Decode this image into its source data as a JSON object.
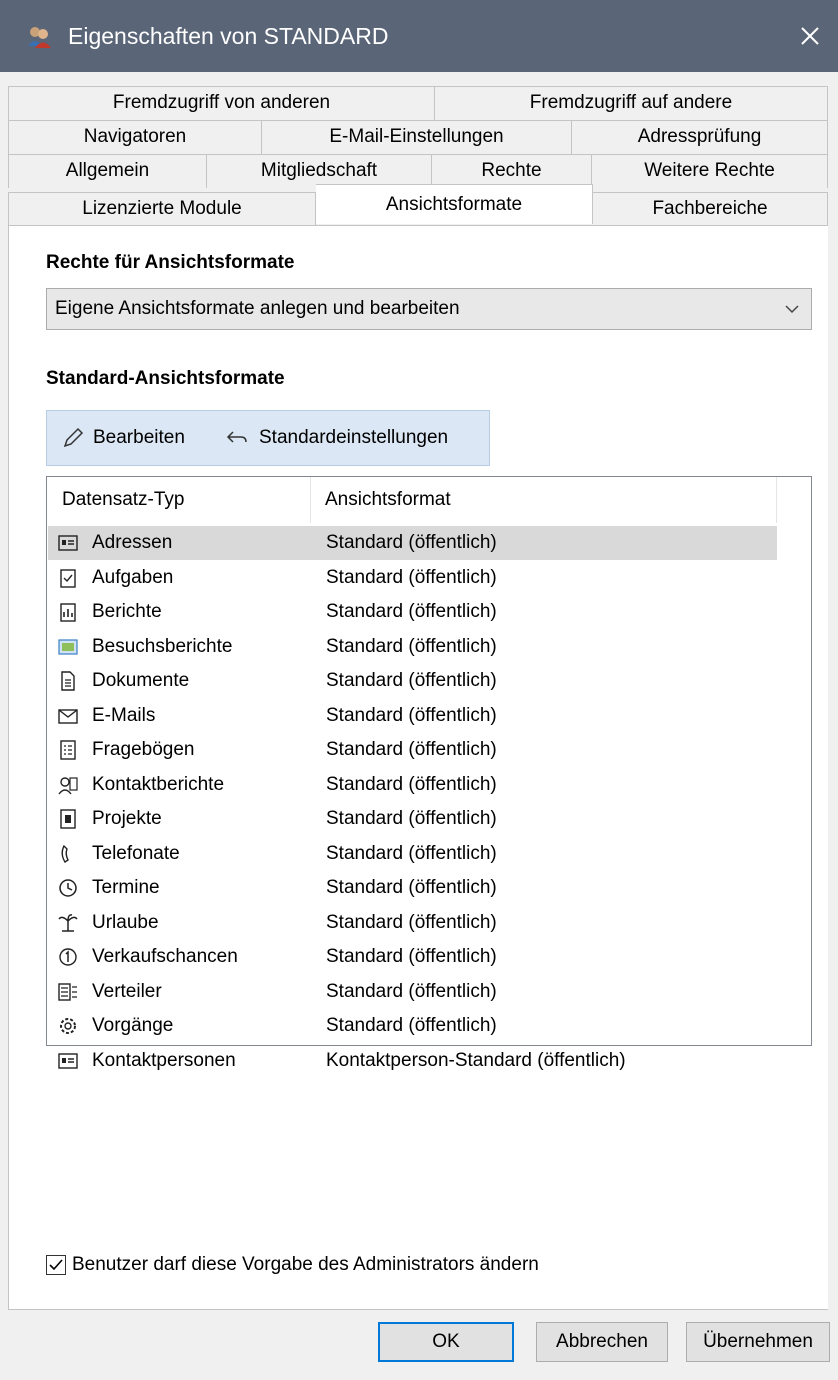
{
  "window": {
    "title": "Eigenschaften von STANDARD"
  },
  "tabs": {
    "row1": [
      "Fremdzugriff von anderen",
      "Fremdzugriff auf andere"
    ],
    "row2": [
      "Navigatoren",
      "E-Mail-Einstellungen",
      "Adressprüfung"
    ],
    "row3": [
      "Allgemein",
      "Mitgliedschaft",
      "Rechte",
      "Weitere Rechte"
    ],
    "row4": [
      "Lizenzierte Module",
      "Ansichtsformate",
      "Fachbereiche"
    ],
    "active": "Ansichtsformate"
  },
  "rights": {
    "title": "Rechte für Ansichtsformate",
    "selected": "Eigene Ansichtsformate anlegen und bearbeiten"
  },
  "standard": {
    "title": "Standard-Ansichtsformate",
    "edit_label": "Bearbeiten",
    "reset_label": "Standardeinstellungen"
  },
  "table": {
    "headers": [
      "Datensatz-Typ",
      "Ansichtsformat"
    ],
    "rows": [
      {
        "type": "Adressen",
        "format": "Standard (öffentlich)",
        "icon": "address-card-icon"
      },
      {
        "type": "Aufgaben",
        "format": "Standard (öffentlich)",
        "icon": "task-icon"
      },
      {
        "type": "Berichte",
        "format": "Standard (öffentlich)",
        "icon": "report-icon"
      },
      {
        "type": "Besuchsberichte",
        "format": "Standard (öffentlich)",
        "icon": "visit-report-icon"
      },
      {
        "type": "Dokumente",
        "format": "Standard (öffentlich)",
        "icon": "document-icon"
      },
      {
        "type": "E-Mails",
        "format": "Standard (öffentlich)",
        "icon": "envelope-icon"
      },
      {
        "type": "Fragebögen",
        "format": "Standard (öffentlich)",
        "icon": "questionnaire-icon"
      },
      {
        "type": "Kontaktberichte",
        "format": "Standard (öffentlich)",
        "icon": "contact-report-icon"
      },
      {
        "type": "Projekte",
        "format": "Standard (öffentlich)",
        "icon": "project-icon"
      },
      {
        "type": "Telefonate",
        "format": "Standard (öffentlich)",
        "icon": "phone-icon"
      },
      {
        "type": "Termine",
        "format": "Standard (öffentlich)",
        "icon": "clock-icon"
      },
      {
        "type": "Urlaube",
        "format": "Standard (öffentlich)",
        "icon": "palm-tree-icon"
      },
      {
        "type": "Verkaufschancen",
        "format": "Standard (öffentlich)",
        "icon": "opportunity-icon"
      },
      {
        "type": "Verteiler",
        "format": "Standard (öffentlich)",
        "icon": "distribution-icon"
      },
      {
        "type": "Vorgänge",
        "format": "Standard (öffentlich)",
        "icon": "gear-icon"
      },
      {
        "type": "Kontaktpersonen",
        "format": "Kontaktperson-Standard (öffentlich)",
        "icon": "contact-card-icon"
      }
    ]
  },
  "checkbox": {
    "label": "Benutzer darf diese Vorgabe des Administrators ändern",
    "checked": true
  },
  "buttons": {
    "ok": "OK",
    "cancel": "Abbrechen",
    "apply": "Übernehmen"
  },
  "colors": {
    "titlebar": "#5a6578",
    "accent": "#0078d7",
    "selection": "#d9d9d9",
    "toolbar": "#dce7f5"
  }
}
